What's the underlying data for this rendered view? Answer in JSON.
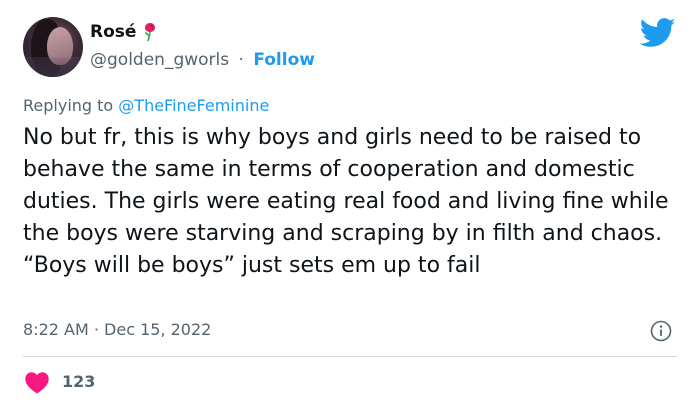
{
  "author": {
    "display_name": "Rosé",
    "name_emoji_icon": "rose-icon",
    "handle": "@golden_gworls",
    "separator": "·",
    "follow_label": "Follow"
  },
  "reply": {
    "prefix": "Replying to",
    "mention": "@TheFineFeminine"
  },
  "tweet": {
    "text": "No but fr, this is why boys and girls need to be raised to behave the same in terms of cooperation and domestic duties. The girls were eating real food and living fine while the boys were starving and scraping by in filth and chaos. “Boys will be boys” just sets em up to fail",
    "time": "8:22 AM",
    "separator": "·",
    "date": "Dec 15, 2022"
  },
  "stats": {
    "likes": "123"
  },
  "colors": {
    "accent": "#1d9bf0",
    "like": "#f91880",
    "muted": "#536471",
    "text": "#0f1419"
  },
  "icons": [
    "avatar",
    "rose-icon",
    "twitter-bird-icon",
    "info-icon",
    "heart-icon"
  ]
}
